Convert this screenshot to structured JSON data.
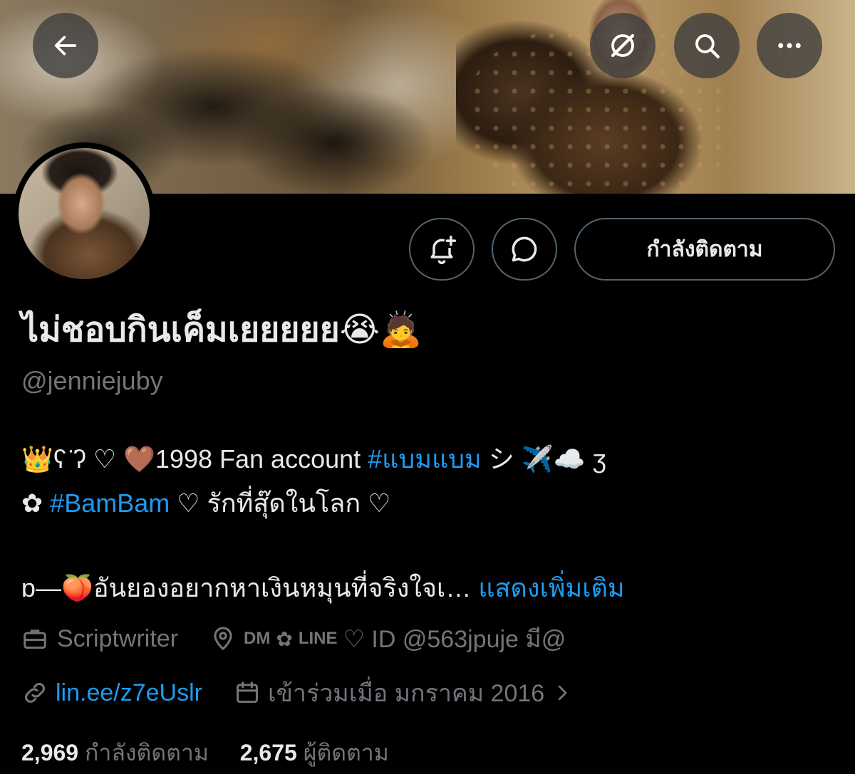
{
  "profile": {
    "display_name": "ไม่ชอบกินเค็มเยยยยย😭🙇",
    "handle": "@jenniejuby"
  },
  "header": {
    "back_label": "",
    "icons": [
      "back-arrow-icon",
      "grok-icon",
      "search-icon",
      "more-icon"
    ]
  },
  "actions": {
    "follow_label": "กำลังติดตาม",
    "icons": [
      "bell-plus-icon",
      "message-icon"
    ]
  },
  "bio": {
    "line1_prefix": "👑ʕ ̈̈ʔ ♡ 🤎1998 Fan account ",
    "line1_hashtag": "#แบมแบม",
    "line1_suffix": " シ ✈️☁️ ʒ",
    "line2_prefix": "✿ ",
    "line2_hashtag": "#BamBam",
    "line2_suffix": " ♡ รักที่สุ๊ดในโลก ♡",
    "line3_text": "ɒ—🍑อันยองอยากหาเงินหมุนที่จริงใจเ… ",
    "line3_more": "แสดงเพิ่มเติม"
  },
  "meta": {
    "profession": "Scriptwriter",
    "location_dm": "DM",
    "location_line": "LINE",
    "location_rest": "♡ ID @563jpuje มี@",
    "website": "lin.ee/z7eUslr",
    "joined": "เข้าร่วมเมื่อ มกราคม 2016"
  },
  "stats": {
    "following_count": "2,969",
    "following_label": "กำลังติดตาม",
    "followers_count": "2,675",
    "followers_label": "ผู้ติดตาม"
  },
  "colors": {
    "background": "#000000",
    "text": "#e7e9ea",
    "secondary": "#71767b",
    "accent": "#1d9bf0"
  }
}
